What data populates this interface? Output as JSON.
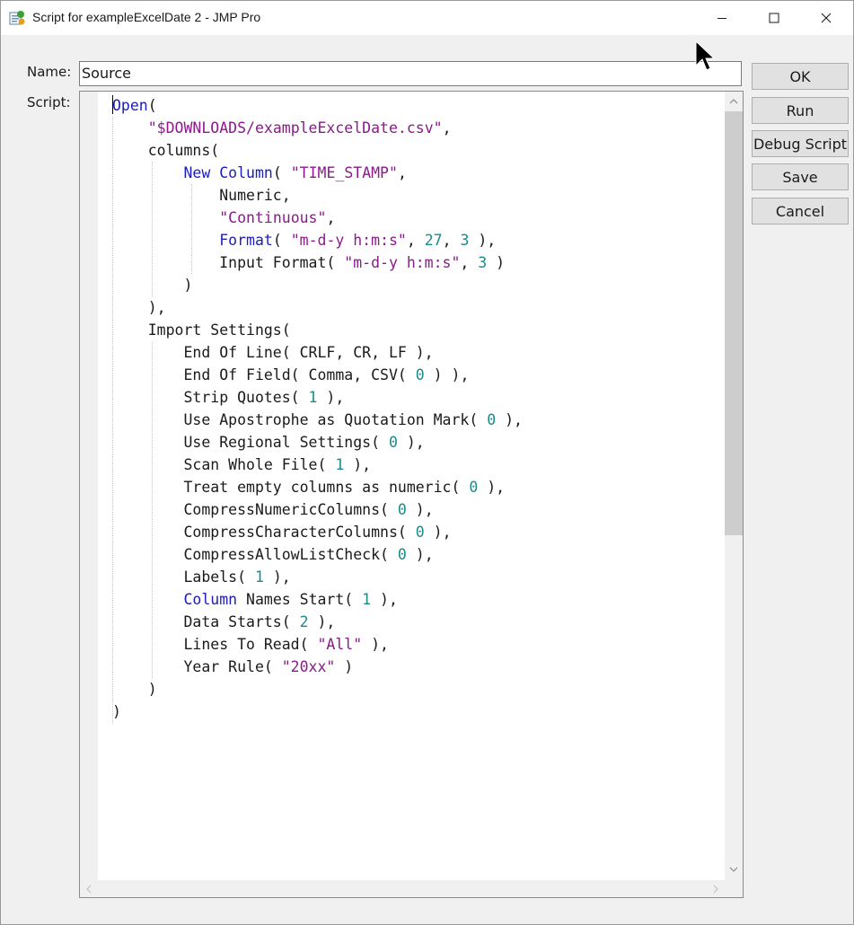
{
  "window": {
    "title": "Script for exampleExcelDate 2 - JMP Pro",
    "controls": {
      "minimize_icon": "minimize-icon",
      "maximize_icon": "maximize-icon",
      "close_icon": "close-icon"
    }
  },
  "form": {
    "name_label": "Name:",
    "name_value": "Source",
    "script_label": "Script:"
  },
  "buttons": {
    "ok": "OK",
    "run": "Run",
    "debug": "Debug Script",
    "save": "Save",
    "cancel": "Cancel"
  },
  "script_lines": [
    "Open(",
    "\"$DOWNLOADS/exampleExcelDate.csv\",",
    "columns(",
    "New Column( \"TIME_STAMP\",",
    "Numeric,",
    "\"Continuous\",",
    "Format( \"m-d-y h:m:s\", 27, 3 ),",
    "Input Format( \"m-d-y h:m:s\", 3 )",
    ")",
    "),",
    "Import Settings(",
    "End Of Line( CRLF, CR, LF ),",
    "End Of Field( Comma, CSV( 0 ) ),",
    "Strip Quotes( 1 ),",
    "Use Apostrophe as Quotation Mark( 0 ),",
    "Use Regional Settings( 0 ),",
    "Scan Whole File( 1 ),",
    "Treat empty columns as numeric( 0 ),",
    "CompressNumericColumns( 0 ),",
    "CompressCharacterColumns( 0 ),",
    "CompressAllowListCheck( 0 ),",
    "Labels( 1 ),",
    "Column Names Start( 1 ),",
    "Data Starts( 2 ),",
    "Lines To Read( \"All\" ),",
    "Year Rule( \"20xx\" )",
    ")",
    ")"
  ],
  "colors": {
    "keyword": "#1c1cb8",
    "string": "#8b1a8b",
    "number": "#1a8a8a"
  }
}
